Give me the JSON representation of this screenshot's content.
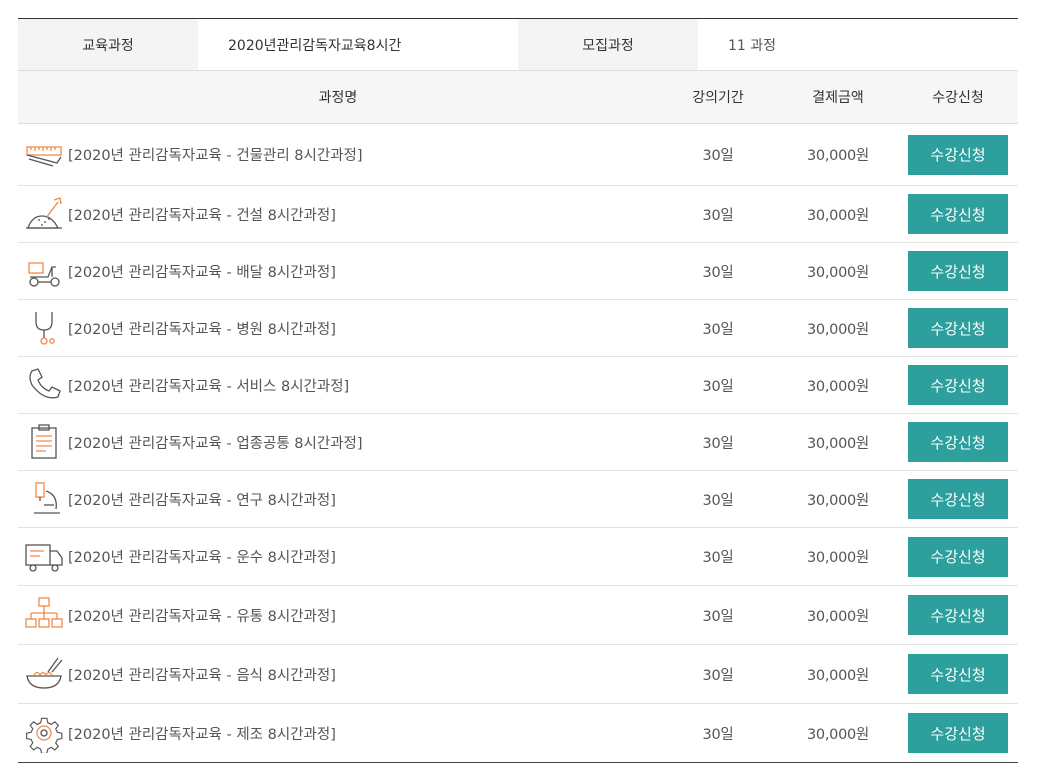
{
  "info": {
    "course_label": "교육과정",
    "course_value": "2020년관리감독자교육8시간",
    "recruit_label": "모집과정",
    "recruit_value": "11 과정"
  },
  "header": {
    "name": "과정명",
    "period": "강의기간",
    "price": "결제금액",
    "apply": "수강신청"
  },
  "rows": [
    {
      "title": "[2020년 관리감독자교육 - 건물관리 8시간과정]",
      "period": "30일",
      "price": "30,000원",
      "button": "수강신청",
      "icon": "measuring-tape-icon"
    },
    {
      "title": "[2020년 관리감독자교육 - 건설 8시간과정]",
      "period": "30일",
      "price": "30,000원",
      "button": "수강신청",
      "icon": "shovel-icon"
    },
    {
      "title": "[2020년 관리감독자교육 - 배달 8시간과정]",
      "period": "30일",
      "price": "30,000원",
      "button": "수강신청",
      "icon": "scooter-icon"
    },
    {
      "title": "[2020년 관리감독자교육 - 병원 8시간과정]",
      "period": "30일",
      "price": "30,000원",
      "button": "수강신청",
      "icon": "stethoscope-icon"
    },
    {
      "title": "[2020년 관리감독자교육 - 서비스 8시간과정]",
      "period": "30일",
      "price": "30,000원",
      "button": "수강신청",
      "icon": "phone-icon"
    },
    {
      "title": "[2020년 관리감독자교육 - 업종공통 8시간과정]",
      "period": "30일",
      "price": "30,000원",
      "button": "수강신청",
      "icon": "clipboard-icon"
    },
    {
      "title": "[2020년 관리감독자교육 - 연구 8시간과정]",
      "period": "30일",
      "price": "30,000원",
      "button": "수강신청",
      "icon": "microscope-icon"
    },
    {
      "title": "[2020년 관리감독자교육 - 운수 8시간과정]",
      "period": "30일",
      "price": "30,000원",
      "button": "수강신청",
      "icon": "truck-icon"
    },
    {
      "title": "[2020년 관리감독자교육 - 유통 8시간과정]",
      "period": "30일",
      "price": "30,000원",
      "button": "수강신청",
      "icon": "org-chart-icon"
    },
    {
      "title": "[2020년 관리감독자교육 - 음식 8시간과정]",
      "period": "30일",
      "price": "30,000원",
      "button": "수강신청",
      "icon": "food-bowl-icon"
    },
    {
      "title": "[2020년 관리감독자교육 - 제조 8시간과정]",
      "period": "30일",
      "price": "30,000원",
      "button": "수강신청",
      "icon": "gear-icon"
    }
  ],
  "colors": {
    "button": "#2d9f9c",
    "icon_line": "#555555",
    "icon_accent": "#f08a4b"
  }
}
